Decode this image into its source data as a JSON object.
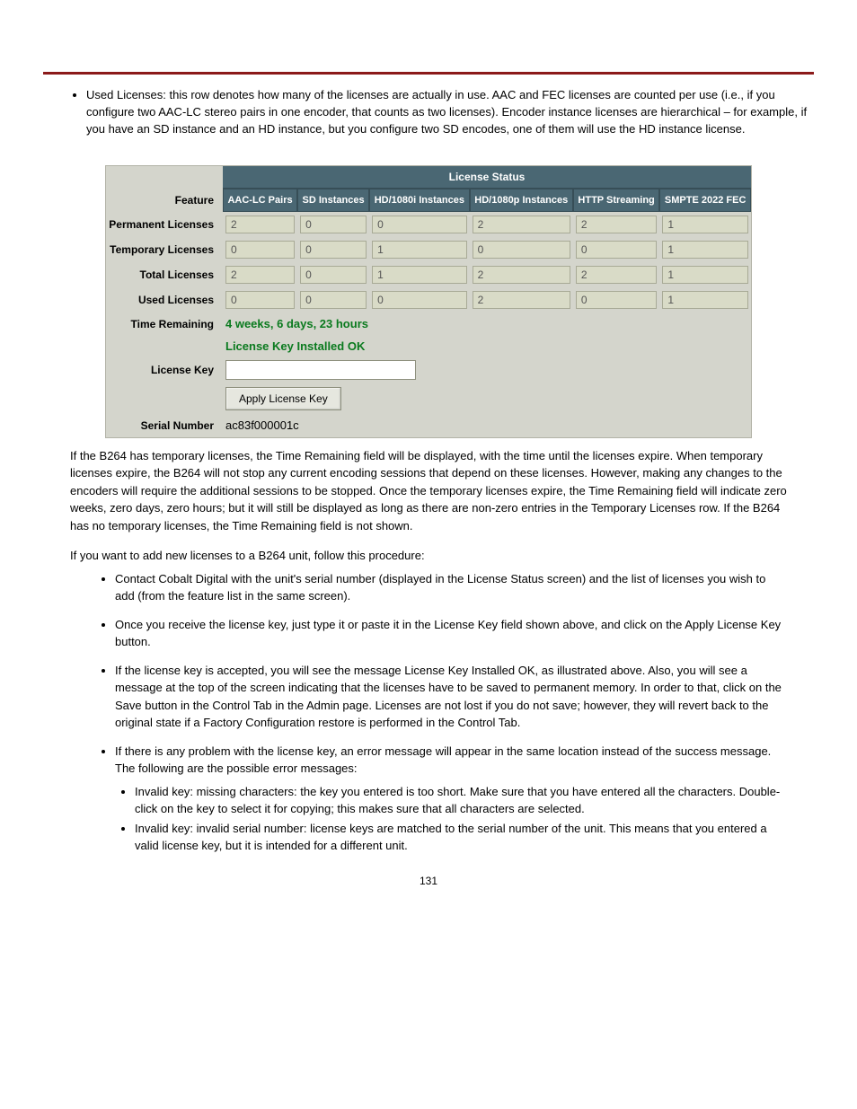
{
  "bullets_top": [
    "Used Licenses: this row denotes how many of the licenses are actually in use.  AAC and FEC licenses are counted per use (i.e., if you configure two AAC-LC stereo pairs in one encoder, that counts as two licenses).  Encoder instance licenses are hierarchical – for example, if you have an SD instance and an HD instance, but you configure two SD encodes, one of them will use the HD instance license."
  ],
  "lic_panel": {
    "title": "License Status",
    "row_labels": {
      "feature": "Feature",
      "perm": "Permanent Licenses",
      "temp": "Temporary Licenses",
      "total": "Total Licenses",
      "used": "Used Licenses",
      "time": "Time Remaining",
      "status": "License Key Installed OK",
      "key": "License Key",
      "apply": "Apply License Key",
      "serial_lbl": "Serial Number",
      "serial_val": "ac83f000001c"
    },
    "cols": [
      "AAC-LC Pairs",
      "SD Instances",
      "HD/1080i Instances",
      "HD/1080p Instances",
      "HTTP Streaming",
      "SMPTE 2022 FEC"
    ],
    "vals": {
      "perm": [
        "2",
        "0",
        "0",
        "2",
        "2",
        "1"
      ],
      "temp": [
        "0",
        "0",
        "1",
        "0",
        "0",
        "1"
      ],
      "total": [
        "2",
        "0",
        "1",
        "2",
        "2",
        "1"
      ],
      "used": [
        "0",
        "0",
        "0",
        "2",
        "0",
        "1"
      ]
    },
    "time_val": "4 weeks, 6 days, 23 hours"
  },
  "para_after_fig": "If the B264 has temporary licenses, the Time Remaining field will be displayed, with the time until the licenses expire.  When temporary licenses expire, the B264 will not stop any current encoding sessions that depend on these licenses.  However, making any changes to the encoders will require the additional sessions to be stopped.  Once the temporary licenses expire, the Time Remaining field will indicate zero weeks, zero days, zero hours; but it will still be displayed as long as there are non-zero entries in the Temporary Licenses row.  If the B264 has no temporary licenses, the Time Remaining field is not shown.",
  "para_key_intro": "If you want to add new licenses to a B264 unit, follow this procedure:",
  "key_steps": [
    "Contact Cobalt Digital with the unit's serial number (displayed in the License Status screen) and the list of licenses you wish to add (from the feature list in the same screen).",
    "Once you receive the license key, just type it or paste it in the License Key field shown above, and click on the Apply License Key button.",
    "If the license key is accepted, you will see the message License Key Installed OK, as illustrated above.  Also, you will see a message at the top of the screen indicating that the licenses have to be saved to permanent memory.  In order to that, click on the Save button in the Control Tab in the Admin page.  Licenses are not lost if you do not save; however, they will revert back to the original state if a Factory Configuration restore is performed in the Control Tab.",
    "If there is any problem with the license key, an error message will appear in the same location instead of the success message.  The following are the possible error messages:"
  ],
  "sub_errors": [
    "Invalid key: missing characters: the key you entered is too short. Make sure that you have entered all the characters.  Double-click on the key to select it for copying; this makes sure that all characters are selected.",
    "Invalid key: invalid serial number: license keys are matched to the serial number of the unit.  This means that you entered a valid license key, but it is intended for a different unit."
  ],
  "page_number": "131"
}
